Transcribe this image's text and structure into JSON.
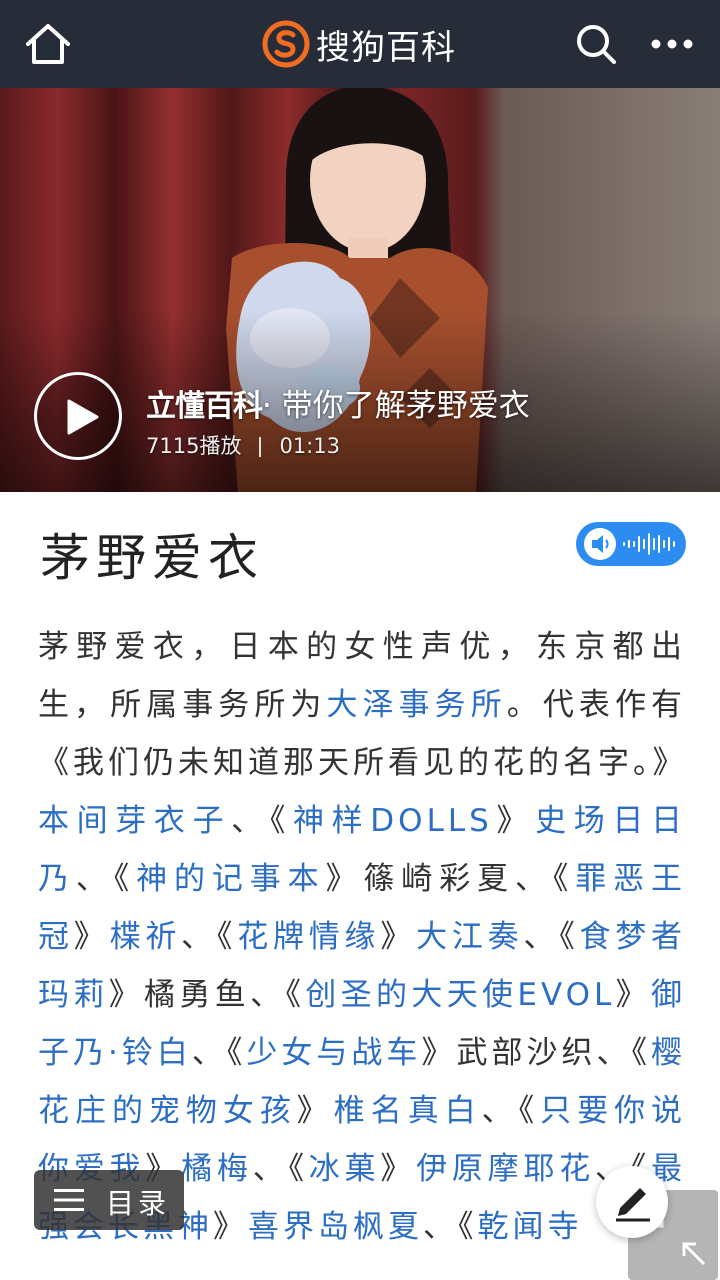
{
  "header": {
    "brand_name": "搜狗百科",
    "icons": [
      "home-icon",
      "sogou-logo",
      "search-icon",
      "more-icon"
    ]
  },
  "video": {
    "brand": "立懂百科",
    "title": "· 带你了解茅野爱衣",
    "plays": "7115播放",
    "duration": "01:13"
  },
  "article": {
    "title": "茅野爱衣",
    "voice_button": "speaker-icon",
    "segments": [
      {
        "t": "茅野爱衣，日本的女性声优，东京都出生，所属事务所为",
        "link": false
      },
      {
        "t": "大泽事务所",
        "link": true
      },
      {
        "t": "。代表作有《我们仍未知道那天所看见的花的名字。》",
        "link": false
      },
      {
        "t": "本间芽衣子",
        "link": true
      },
      {
        "t": "、《",
        "link": false
      },
      {
        "t": "神样DOLLS",
        "link": true
      },
      {
        "t": "》",
        "link": false
      },
      {
        "t": "史场日日乃",
        "link": true
      },
      {
        "t": "、《",
        "link": false
      },
      {
        "t": "神的记事本",
        "link": true
      },
      {
        "t": "》篠崎彩夏、《",
        "link": false
      },
      {
        "t": "罪恶王冠",
        "link": true
      },
      {
        "t": "》",
        "link": false
      },
      {
        "t": "楪祈",
        "link": true
      },
      {
        "t": "、《",
        "link": false
      },
      {
        "t": "花牌情缘",
        "link": true
      },
      {
        "t": "》",
        "link": false
      },
      {
        "t": "大江奏",
        "link": true
      },
      {
        "t": "、《",
        "link": false
      },
      {
        "t": "食梦者玛莉",
        "link": true
      },
      {
        "t": "》橘勇鱼、《",
        "link": false
      },
      {
        "t": "创圣的大天使EVOL",
        "link": true
      },
      {
        "t": "》",
        "link": false
      },
      {
        "t": "御子乃·铃白",
        "link": true
      },
      {
        "t": "、《",
        "link": false
      },
      {
        "t": "少女与战车",
        "link": true
      },
      {
        "t": "》武部沙织、《",
        "link": false
      },
      {
        "t": "樱花庄的宠物女孩",
        "link": true
      },
      {
        "t": "》",
        "link": false
      },
      {
        "t": "椎名真白",
        "link": true
      },
      {
        "t": "、《",
        "link": false
      },
      {
        "t": "只要你说你爱我",
        "link": true
      },
      {
        "t": "》",
        "link": false
      },
      {
        "t": "橘梅",
        "link": true
      },
      {
        "t": "、《",
        "link": false
      },
      {
        "t": "冰菓",
        "link": true
      },
      {
        "t": "》",
        "link": false
      },
      {
        "t": "伊原摩耶花",
        "link": true
      },
      {
        "t": "、《",
        "link": false
      },
      {
        "t": "最强会长黑神",
        "link": true
      },
      {
        "t": "》",
        "link": false
      },
      {
        "t": "喜界岛枫夏",
        "link": true
      },
      {
        "t": "、《",
        "link": false
      },
      {
        "t": "乾闻寺",
        "link": true
      }
    ]
  },
  "toc": {
    "label": "目录"
  },
  "colors": {
    "topbar": "#262c38",
    "link": "#2d6ec5",
    "accent": "#2d8cf0",
    "logo": "#f26c21"
  }
}
